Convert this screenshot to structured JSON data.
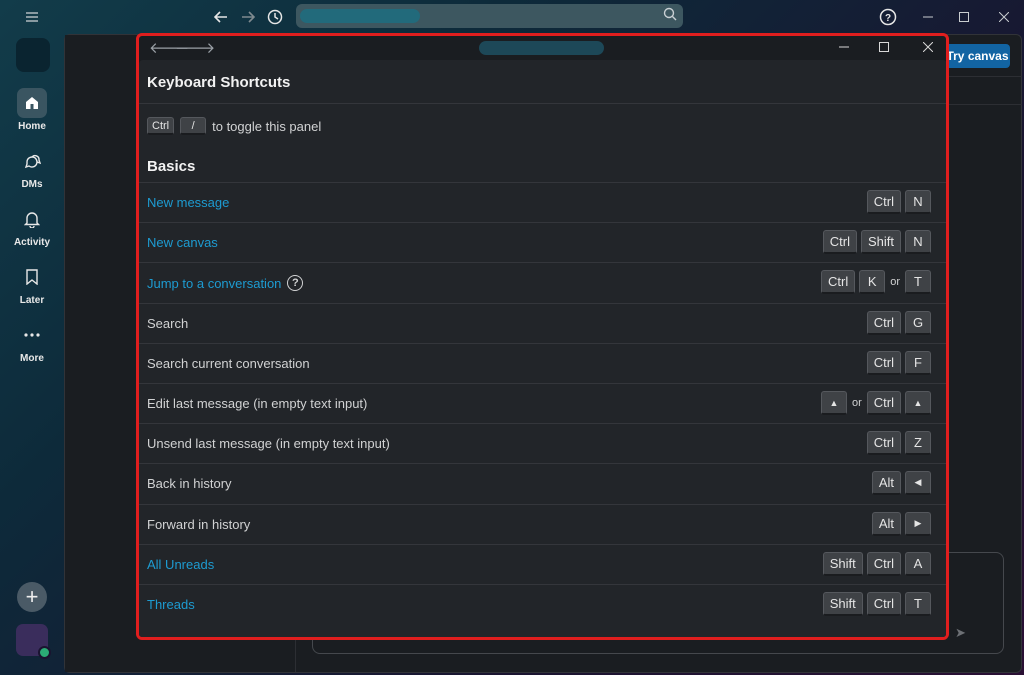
{
  "topbar": {
    "menu_icon": "hamburger-icon",
    "back_icon": "arrow-left-icon",
    "forward_icon": "arrow-right-icon",
    "history_icon": "clock-icon",
    "search_icon": "search-icon",
    "help_icon": "help-circle-icon"
  },
  "rail": {
    "items": [
      {
        "label": "Home",
        "icon": "home-icon"
      },
      {
        "label": "DMs",
        "icon": "dms-icon"
      },
      {
        "label": "Activity",
        "icon": "bell-icon"
      },
      {
        "label": "Later",
        "icon": "bookmark-icon"
      },
      {
        "label": "More",
        "icon": "more-icon"
      }
    ],
    "add_icon": "plus-icon"
  },
  "workspace": {
    "try_canvas_label": "Try canvas"
  },
  "modal": {
    "title": "Keyboard Shortcuts",
    "toggle": {
      "keys": [
        "Ctrl",
        "/"
      ],
      "text": "to toggle this panel"
    },
    "section_title": "Basics",
    "or_text": "or",
    "shortcuts": [
      {
        "label": "New message",
        "link": true,
        "keys": [
          "Ctrl",
          "N"
        ]
      },
      {
        "label": "New canvas",
        "link": true,
        "keys": [
          "Ctrl",
          "Shift",
          "N"
        ]
      },
      {
        "label": "Jump to a conversation",
        "link": true,
        "help": true,
        "keys": [
          "Ctrl",
          "K",
          "or",
          "T"
        ]
      },
      {
        "label": "Search",
        "link": false,
        "keys": [
          "Ctrl",
          "G"
        ]
      },
      {
        "label": "Search current conversation",
        "link": false,
        "keys": [
          "Ctrl",
          "F"
        ]
      },
      {
        "label": "Edit last message (in empty text input)",
        "link": false,
        "keys": [
          "▲",
          "or",
          "Ctrl",
          "▲"
        ]
      },
      {
        "label": "Unsend last message (in empty text input)",
        "link": false,
        "keys": [
          "Ctrl",
          "Z"
        ]
      },
      {
        "label": "Back in history",
        "link": false,
        "keys": [
          "Alt",
          "◀"
        ]
      },
      {
        "label": "Forward in history",
        "link": false,
        "keys": [
          "Alt",
          "▶"
        ]
      },
      {
        "label": "All Unreads",
        "link": true,
        "keys": [
          "Shift",
          "Ctrl",
          "A"
        ]
      },
      {
        "label": "Threads",
        "link": true,
        "keys": [
          "Shift",
          "Ctrl",
          "T"
        ]
      }
    ]
  }
}
